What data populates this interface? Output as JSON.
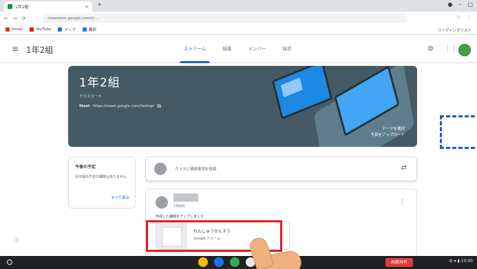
{
  "browser": {
    "tab_title": "1年2組",
    "tab_close": "×",
    "new_tab": "+",
    "window_controls": [
      "●",
      "–",
      "▢"
    ],
    "nav": [
      "←",
      "→",
      "⟳"
    ],
    "url": "classroom.google.com/c/…",
    "toolbar_right": [
      "☆",
      "⋮"
    ],
    "bookmarks": [
      {
        "label": "Gmail",
        "color": "#d93025"
      },
      {
        "label": "YouTube",
        "color": "#ff0000"
      },
      {
        "label": "マップ",
        "color": "#1a73e8"
      },
      {
        "label": "翻訳",
        "color": "#1a73e8"
      }
    ],
    "bookmarks_right": "リーディングリスト"
  },
  "app": {
    "menu_icon": "≡",
    "class_name": "1年2組",
    "tabs": [
      "ストリーム",
      "授業",
      "メンバー",
      "採点"
    ],
    "settings_icon": "⚙",
    "apps_icon": "⋮⋮",
    "avatar_color": "#43a047"
  },
  "banner": {
    "title": "1年2組",
    "class_code": "クラスコード",
    "meet_label": "Meet",
    "meet_link": "https://meet.google.com/lookup/",
    "meet_icon": "⧉",
    "right_text": [
      "テーマを選択",
      "写真をアップロード"
    ]
  },
  "upcoming": {
    "title": "今後の予定",
    "text": "近日提出予定の課題はありません",
    "link": "すべて表示"
  },
  "announce": {
    "placeholder": "クラスに連絡事項を投稿",
    "repost_icon": "⇄"
  },
  "post": {
    "date": "7月8日",
    "body": "作成した課題をアップしました",
    "more_icon": "⋮",
    "attachment": {
      "title": "れんしゅうかんすう",
      "subtitle": "Google フォーム"
    }
  },
  "help_icon": "ⓘ",
  "shelf": {
    "red_button": "画面共有",
    "status": "⚙ ▾ ▮ 10:00",
    "apps": [
      {
        "name": "chrome",
        "color": "#fbbc04"
      },
      {
        "name": "files",
        "color": "#1a73e8"
      },
      {
        "name": "classroom",
        "color": "#34a853"
      },
      {
        "name": "store",
        "color": "#e8eaed"
      },
      {
        "name": "meet",
        "color": "#4285f4"
      }
    ]
  },
  "colors": {
    "accent": "#1967d2",
    "banner": "#455a64",
    "highlight": "#e8191a",
    "dashed": "#1a56d6"
  }
}
